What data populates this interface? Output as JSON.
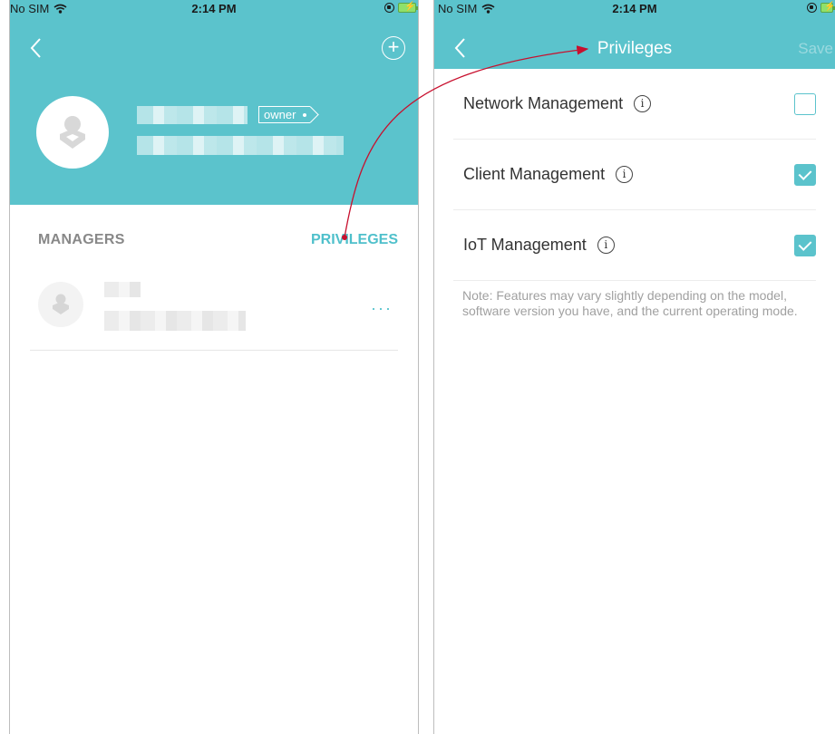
{
  "status_bar": {
    "carrier": "No SIM",
    "time": "2:14 PM"
  },
  "left_screen": {
    "owner_badge": "owner",
    "section_title": "MANAGERS",
    "privileges_link": "PRIVILEGES",
    "manager_more": "···"
  },
  "right_screen": {
    "title": "Privileges",
    "save": "Save",
    "privileges": [
      {
        "label": "Network Management",
        "checked": false
      },
      {
        "label": "Client Management",
        "checked": true
      },
      {
        "label": "IoT Management",
        "checked": true
      }
    ],
    "note": "Note: Features may vary slightly depending on the model, software version you have, and the current operating mode."
  },
  "colors": {
    "accent": "#5bc3cc",
    "annotation_arrow": "#c8102e"
  },
  "icons": [
    "back-icon",
    "add-icon",
    "info-icon",
    "wifi-icon",
    "battery-icon"
  ]
}
